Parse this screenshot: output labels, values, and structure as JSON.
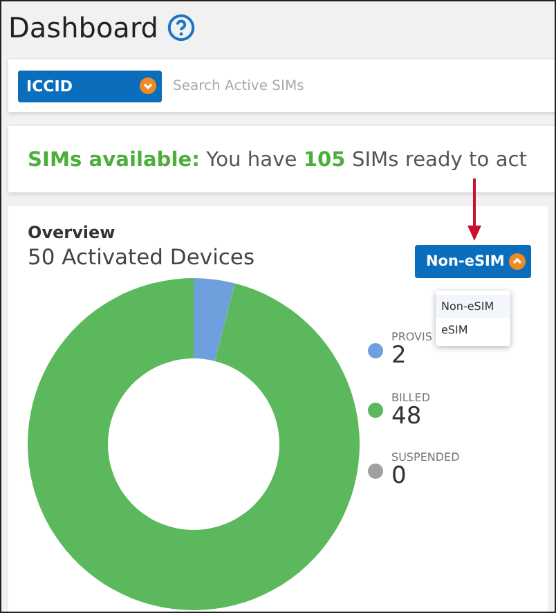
{
  "page": {
    "title": "Dashboard"
  },
  "search": {
    "filter": "ICCID",
    "placeholder": "Search Active SIMs"
  },
  "banner": {
    "text": "**SIMs available:** You have **105** SIMs ready to act"
  },
  "overview": {
    "title": "Overview",
    "subtitle": "50 Activated Devices",
    "type_dropdown": {
      "label": "Non-eSIM",
      "expanded": true,
      "options": [
        {
          "label": "Non-eSIM",
          "selected": true
        },
        {
          "label": "eSIM",
          "selected": false
        }
      ]
    },
    "legend": [
      {
        "label": "PROVIS",
        "value": "2",
        "color": "#6f9fdc"
      },
      {
        "label": "BILLED",
        "value": "48",
        "color": "#5cb85c"
      },
      {
        "label": "SUSPENDED",
        "value": "0",
        "color": "#a0a0a0"
      }
    ]
  }
}
